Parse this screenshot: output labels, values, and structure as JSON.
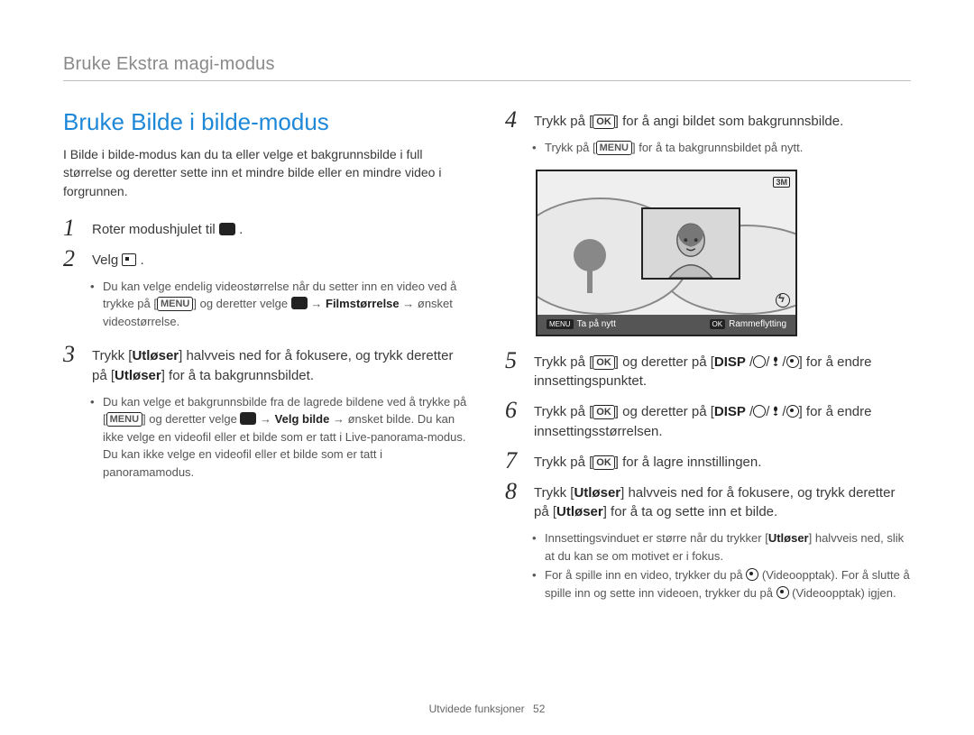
{
  "header": {
    "breadcrumb": "Bruke Ekstra magi-modus"
  },
  "title": "Bruke Bilde i bilde-modus",
  "intro": "I Bilde i bilde-modus kan du ta eller velge et bakgrunnsbilde i full størrelse og deretter sette inn et mindre bilde eller en mindre video i forgrunnen.",
  "labels": {
    "menu": "MENU",
    "ok": "OK",
    "disp": "DISP",
    "utloser": "Utløser",
    "filmstorrelse": "Filmstørrelse",
    "velg_bilde": "Velg bilde",
    "lcd_quality": "3M",
    "lcd_left_tag": "MENU",
    "lcd_left_text": "Ta på nytt",
    "lcd_right_tag": "OK",
    "lcd_right_text": "Rammeflytting"
  },
  "steps_left": {
    "1": {
      "text_a": "Roter modushjulet til ",
      "text_b": " ."
    },
    "2": {
      "text_a": "Velg ",
      "text_b": " .",
      "sub": [
        {
          "a": "Du kan velge endelig videostørrelse når du setter inn en video ved å trykke på [",
          "menu": true,
          "b": "] og deretter velge ",
          "icon": "video",
          "c": " → ",
          "bold": "Filmstørrelse",
          "d": " → ønsket videostørrelse."
        }
      ]
    },
    "3": {
      "a": "Trykk [",
      "ut1": true,
      "b": "] halvveis ned for å fokusere, og trykk deretter på [",
      "ut2": true,
      "c": "] for å ta bakgrunnsbildet.",
      "sub": [
        {
          "a": "Du kan velge et bakgrunnsbilde fra de lagrede bildene ved å trykke på [",
          "menu": true,
          "b": "] og deretter velge ",
          "icon": "camera",
          "c": " → ",
          "bold": "Velg bilde",
          "d": " → ønsket bilde. Du kan ikke velge en videofil eller et bilde som er tatt i Live-panorama-modus. Du kan ikke velge en videofil eller et bilde som er tatt i panoramamodus."
        }
      ]
    }
  },
  "steps_right": {
    "4": {
      "a": "Trykk på [",
      "ok": true,
      "b": "] for å angi bildet som bakgrunnsbilde.",
      "sub": [
        {
          "a": "Trykk på [",
          "menu": true,
          "b": "] for å ta bakgrunnsbildet på nytt."
        }
      ]
    },
    "5": {
      "a": "Trykk på [",
      "ok": true,
      "b": "] og deretter på [",
      "disp": true,
      "c": "] for å endre innsettingspunktet."
    },
    "6": {
      "a": "Trykk på [",
      "ok": true,
      "b": "] og deretter på [",
      "disp": true,
      "c": "] for å endre innsettingsstørrelsen."
    },
    "7": {
      "a": "Trykk på [",
      "ok": true,
      "b": "] for å lagre innstillingen."
    },
    "8": {
      "a": "Trykk [",
      "ut1": true,
      "b": "] halvveis ned for å fokusere, og trykk deretter på [",
      "ut2": true,
      "c": "] for å ta og sette inn et bilde.",
      "sub": [
        {
          "a": "Innsettingsvinduet er større når du trykker [",
          "bold": "Utløser",
          "b": "] halvveis ned, slik at du kan se om motivet er i fokus."
        },
        {
          "a": "For å spille inn en video, trykker du på ",
          "icon": "rec",
          "b": " (Videoopptak). For å slutte å spille inn og sette inn videoen, trykker du på ",
          "icon2": "rec",
          "c": " (Videoopptak) igjen."
        }
      ]
    }
  },
  "footer": {
    "section": "Utvidede funksjoner",
    "page": "52"
  }
}
